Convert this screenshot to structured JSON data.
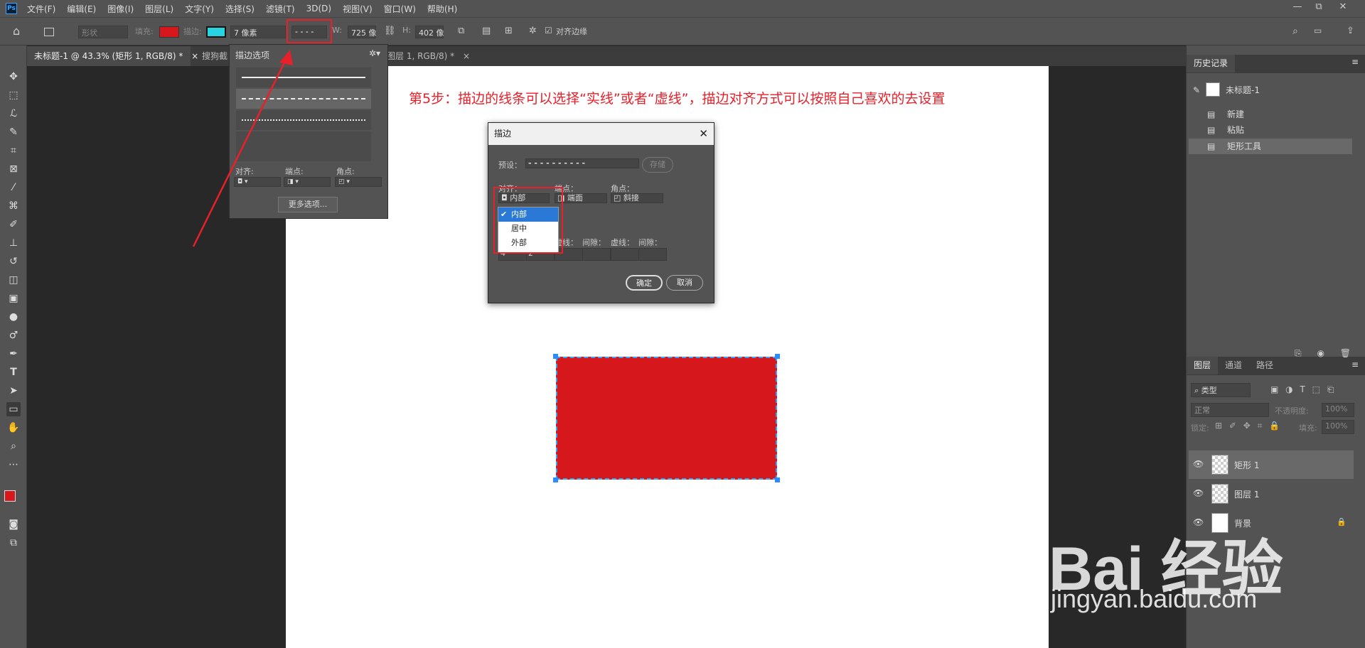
{
  "app": {
    "logo": "Ps"
  },
  "menu": [
    "文件(F)",
    "编辑(E)",
    "图像(I)",
    "图层(L)",
    "文字(Y)",
    "选择(S)",
    "滤镜(T)",
    "3D(D)",
    "视图(V)",
    "窗口(W)",
    "帮助(H)"
  ],
  "window_controls": {
    "minimize": "—",
    "restore": "⧉",
    "close": "✕"
  },
  "options": {
    "shape_mode": "形状",
    "fill_label": "填充:",
    "fill_color": "#d6171b",
    "stroke_label": "描边:",
    "stroke_color": "#27d5e0",
    "stroke_width": "7 像素",
    "stroke_type": "- - - -",
    "w_label": "W:",
    "w_value": "725 像",
    "h_label": "H:",
    "h_value": "402 像",
    "align_edges": "对齐边缘"
  },
  "tabs": [
    {
      "label": "未标题-1 @ 43.3% (矩形 1, RGB/8) *",
      "close": "×",
      "active": true
    },
    {
      "label": "搜狗截",
      "active": false
    },
    {
      "label": "图层 1, RGB/8) *",
      "close": "×",
      "active": false
    }
  ],
  "stroke_popup": {
    "title": "描边选项",
    "align_label": "对齐:",
    "caps_label": "端点:",
    "corners_label": "角点:",
    "more_options": "更多选项..."
  },
  "instruction": "第5步：描边的线条可以选择“实线”或者“虚线”，描边对齐方式可以按照自己喜欢的去设置",
  "dialog": {
    "title": "描边",
    "preset_label": "预设：",
    "preset_value": "- - - - - - - - - -",
    "save_btn": "存储",
    "align_label": "对齐：",
    "align_value": "内部",
    "caps_label": "端点：",
    "caps_value": "端面",
    "corners_label": "角点：",
    "corners_value": "斜接",
    "dash_label": "虚线：",
    "gap_label": "间隙：",
    "dash1": "4",
    "gap1": "2",
    "ok": "确定",
    "cancel": "取消",
    "dropdown": [
      "内部",
      "居中",
      "外部"
    ]
  },
  "history": {
    "tab": "历史记录",
    "snapshot": "未标题-1",
    "items": [
      "新建",
      "粘贴",
      "矩形工具"
    ]
  },
  "layers": {
    "tabs": [
      "图层",
      "通道",
      "路径"
    ],
    "filter": "类型",
    "blend": "正常",
    "opacity_label": "不透明度:",
    "opacity": "100%",
    "lock_label": "锁定:",
    "fill_label": "填充:",
    "fill": "100%",
    "items": [
      "矩形 1",
      "图层 1",
      "背景"
    ]
  },
  "watermark": {
    "line1": "Bai  经验",
    "line2": "jingyan.baidu.com"
  }
}
